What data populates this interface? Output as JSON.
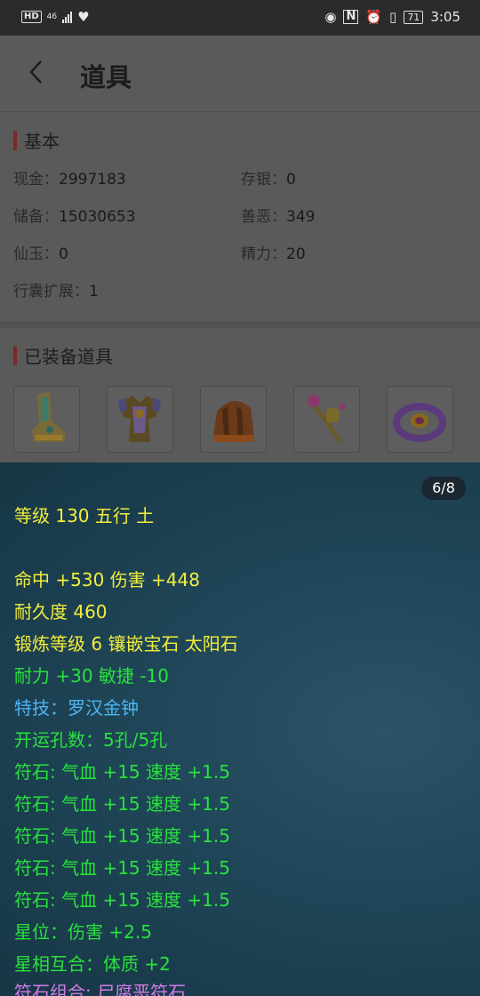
{
  "status_bar": {
    "hd": "HD",
    "network": "46",
    "time": "3:05",
    "battery": "71"
  },
  "header": {
    "title": "道具"
  },
  "basic": {
    "title": "基本",
    "fields": [
      {
        "label": "现金：",
        "value": "2997183"
      },
      {
        "label": "存银：",
        "value": "0"
      },
      {
        "label": "储备：",
        "value": "15030653"
      },
      {
        "label": "善恶：",
        "value": "349"
      },
      {
        "label": "仙玉：",
        "value": "0"
      },
      {
        "label": "精力：",
        "value": "20"
      },
      {
        "label": "行囊扩展：",
        "value": "1"
      }
    ]
  },
  "equipped": {
    "title": "已装备道具",
    "items": [
      {
        "icon": "boots-icon"
      },
      {
        "icon": "armor-icon"
      },
      {
        "icon": "helmet-icon"
      },
      {
        "icon": "wand-icon"
      },
      {
        "icon": "bracelet-icon"
      }
    ]
  },
  "tooltip": {
    "pager": "6/8",
    "lines": [
      {
        "text": "等级 130 五行 土",
        "color": "yellow"
      },
      {
        "text": "命中 +530 伤害 +448",
        "color": "yellow"
      },
      {
        "text": "耐久度 460",
        "color": "yellow"
      },
      {
        "text": "锻炼等级 6 镶嵌宝石 太阳石",
        "color": "yellow"
      },
      {
        "text": "耐力 +30 敏捷 -10",
        "color": "green"
      },
      {
        "text": "特技：罗汉金钟",
        "color": "blue"
      },
      {
        "text": "开运孔数：5孔/5孔",
        "color": "green"
      },
      {
        "text": "符石: 气血 +15 速度 +1.5",
        "color": "green"
      },
      {
        "text": "符石: 气血 +15 速度 +1.5",
        "color": "green"
      },
      {
        "text": "符石: 气血 +15 速度 +1.5",
        "color": "green"
      },
      {
        "text": "符石: 气血 +15 速度 +1.5",
        "color": "green"
      },
      {
        "text": "符石: 气血 +15 速度 +1.5",
        "color": "green"
      },
      {
        "text": "星位：伤害 +2.5",
        "color": "green"
      },
      {
        "text": "星相互合：体质 +2",
        "color": "green"
      },
      {
        "text": "符石组合: 尸腐恶符石",
        "color": "purple"
      }
    ]
  },
  "colors": {
    "section_marker": "#7a2a2a",
    "yellow_text": "#f2ee3a",
    "green_text": "#28e23c",
    "blue_text": "#4fb5f2",
    "purple_text": "#d07be8"
  }
}
